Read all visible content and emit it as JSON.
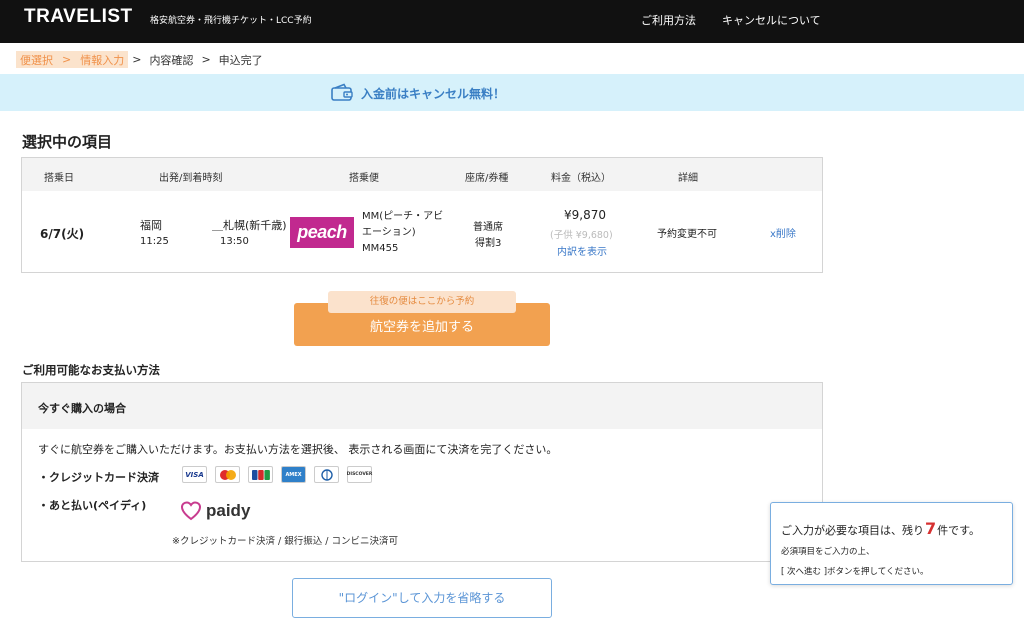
{
  "header": {
    "logo": "TRAVELIST",
    "tagline": "格安航空券・飛行機チケット・LCC予約",
    "nav_how": "ご利用方法",
    "nav_cancel": "キャンセルについて"
  },
  "breadcrumb": {
    "step1": "便選択",
    "sep": ">",
    "step2": "情報入力",
    "step3": "内容確認",
    "step4": "申込完了"
  },
  "banner": {
    "text": "入金前はキャンセル無料！"
  },
  "selected": {
    "title": "選択中の項目",
    "columns": [
      "搭乗日",
      "出発/到着時刻",
      "搭乗便",
      "座席/券種",
      "料金（税込）",
      "詳細"
    ],
    "row": {
      "date": "6/7(火)",
      "dep_city": "福岡",
      "dep_time": "11:25",
      "arr_city": "＿札幌(新千歳)",
      "arr_time": "13:50",
      "airline_logo": "peach",
      "flight_name": "MM(ピーチ・アビエーション)",
      "flight_no": "MM455",
      "seat_class": "普通席",
      "fare_type": "得割3",
      "price": "¥9,870",
      "child_price": "(子供 ¥9,680)",
      "breakdown_link": "内訳を表示",
      "detail": "予約変更不可",
      "remove": "x削除"
    }
  },
  "add_ticket": {
    "tag": "往復の便はここから予約",
    "button": "航空券を追加する"
  },
  "payment": {
    "title": "ご利用可能なお支払い方法",
    "box_title": "今すぐ購入の場合",
    "description": "すぐに航空券をご購入いただけます。お支払い方法を選択後、 表示される画面にて決済を完了ください。",
    "credit_label": "・クレジットカード決済",
    "cards": [
      "VISA",
      "MC",
      "JCB",
      "AMEX",
      "Diners",
      "DISCOVER"
    ],
    "later_label": "・あと払い(ペイディ)",
    "paidy_word": "paidy",
    "paidy_note": "※クレジットカード決済 / 銀行振込 / コンビニ決済可"
  },
  "login_button": "\"ログイン\"して入力を省略する",
  "notice": {
    "prefix": "ご入力が必要な項目は、残り",
    "count": "7",
    "suffix": "件です。",
    "line1": "必須項目をご入力の上、",
    "line2": "[ 次へ進む ]ボタンを押してください。"
  },
  "colors": {
    "accent_orange": "#f2a150",
    "banner_blue": "#d6f1fb",
    "peach_magenta": "#c1298f",
    "link_blue": "#3a78c8",
    "count_red": "#d63030"
  }
}
